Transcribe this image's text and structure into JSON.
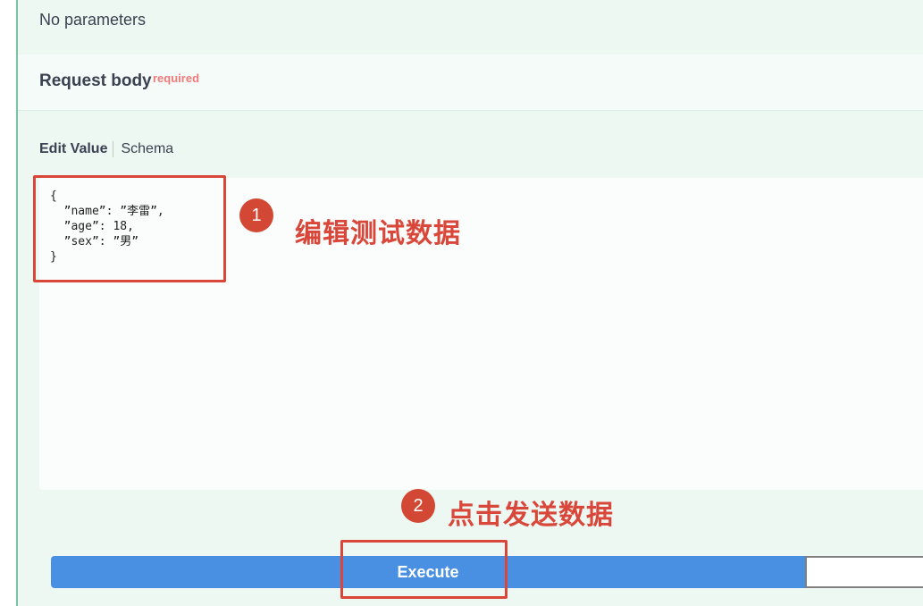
{
  "parameters": {
    "empty_text": "No parameters"
  },
  "request_body": {
    "title": "Request body",
    "required_label": "required",
    "tabs": {
      "edit_value": "Edit Value",
      "schema": "Schema"
    },
    "editor_value": "{\n  ”name”: ”李雷”,\n  ”age”: 18,\n  ”sex”: ”男”\n}"
  },
  "annotations": [
    {
      "number": "1",
      "text": "编辑测试数据"
    },
    {
      "number": "2",
      "text": "点击发送数据"
    }
  ],
  "actions": {
    "execute_label": "Execute",
    "clear_label": ""
  },
  "colors": {
    "accent": "#4990e2",
    "annotation_red": "#d9473a",
    "panel_bg": "#eef8f3",
    "required": "#f07a7a"
  }
}
